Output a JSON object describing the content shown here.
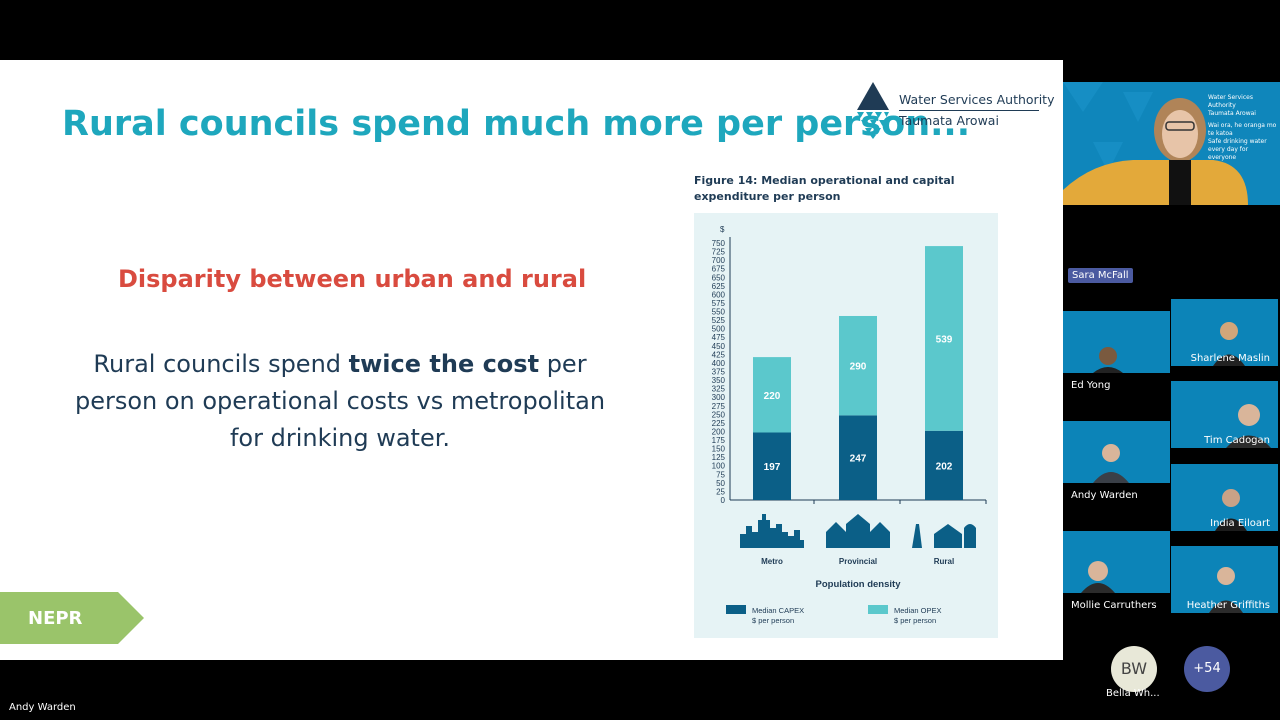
{
  "slide": {
    "title": "Rural councils spend much more per person...",
    "logo": {
      "line1": "Water Services Authority",
      "line2": "Taumata Arowai"
    },
    "subhead": "Disparity between urban and rural",
    "body": {
      "pre": "Rural councils spend ",
      "bold": "twice the cost",
      "post": " per person on operational costs vs metropolitan for drinking water."
    },
    "tag": "NEPR",
    "figure_title": "Figure 14: Median operational and capital expenditure per person"
  },
  "chart_data": {
    "type": "bar",
    "stacked": true,
    "categories": [
      "Metro",
      "Provincial",
      "Rural"
    ],
    "series": [
      {
        "name": "Median CAPEX $ per person",
        "values": [
          197,
          247,
          202
        ],
        "color": "#0b5f87"
      },
      {
        "name": "Median OPEX $ per person",
        "values": [
          220,
          290,
          539
        ],
        "color": "#5bc8cc"
      }
    ],
    "ylabel": "$",
    "xlabel": "Population density",
    "ylim": [
      0,
      750
    ],
    "yticks": [
      "0",
      "25",
      "50",
      "75",
      "100",
      "125",
      "150",
      "175",
      "200",
      "225",
      "250",
      "275",
      "300",
      "325",
      "350",
      "375",
      "400",
      "425",
      "450",
      "475",
      "500",
      "525",
      "550",
      "575",
      "600",
      "625",
      "650",
      "675",
      "700",
      "725",
      "750"
    ],
    "legend": [
      {
        "line1": "Median CAPEX",
        "line2": "$ per person"
      },
      {
        "line1": "Median OPEX",
        "line2": "$ per person"
      }
    ],
    "legend_position": "bottom"
  },
  "meeting": {
    "presenter": {
      "name": "Sara McFall",
      "slide_line1": "Water Services Authority",
      "slide_line2": "Taumata Arowai",
      "slide_line3": "Wai ora, he oranga mo te katoa",
      "slide_line4": "Safe drinking water every day for everyone"
    },
    "participants": [
      {
        "name": "Ed Yong"
      },
      {
        "name": "Sharlene Maslin"
      },
      {
        "name": "Tim Cadogan"
      },
      {
        "name": "Andy Warden"
      },
      {
        "name": "India Eiloart"
      },
      {
        "name": "Mollie Carruthers"
      },
      {
        "name": "Heather Griffiths"
      }
    ],
    "overflow": {
      "initials": "BW",
      "name": "Bella Wh...",
      "more": "+54"
    },
    "active_speaker": "Andy Warden",
    "colors": {
      "tile": "#0c84b8",
      "pill": "#4b5aa0",
      "more": "#4b5aa0"
    }
  }
}
